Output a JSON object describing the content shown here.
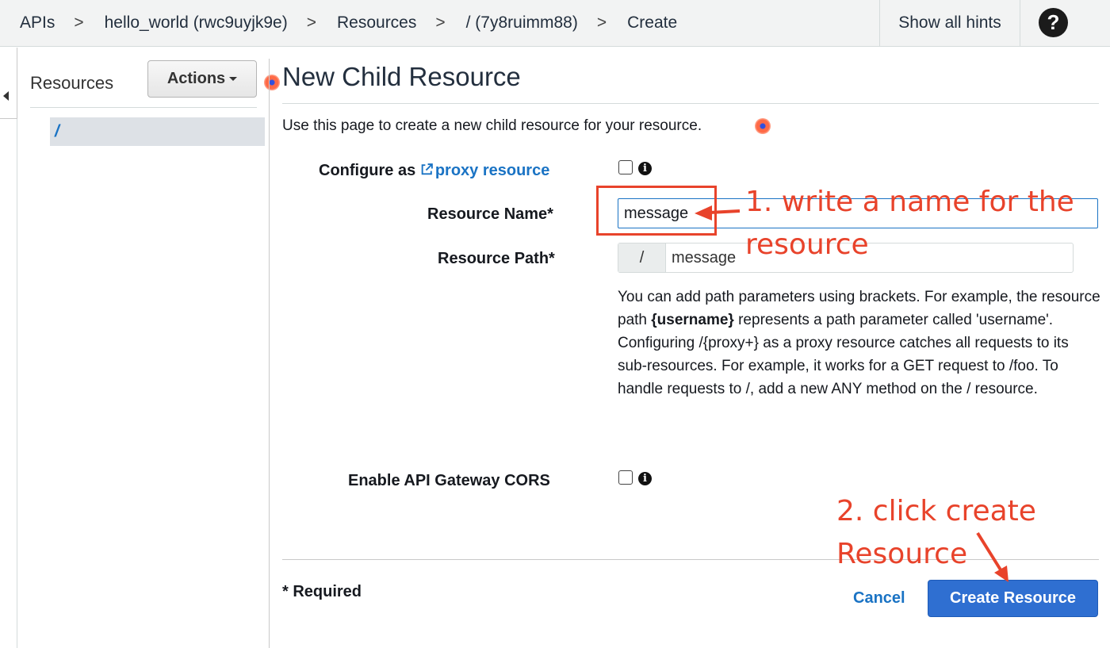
{
  "breadcrumb": [
    {
      "label": "APIs"
    },
    {
      "label": "hello_world (rwc9uyjk9e)"
    },
    {
      "label": "Resources"
    },
    {
      "label": "/ (7y8ruimm88)"
    },
    {
      "label": "Create"
    }
  ],
  "breadcrumb_separator": ">",
  "header": {
    "show_hints_label": "Show all hints",
    "help_icon_glyph": "?"
  },
  "sidebar": {
    "title": "Resources",
    "actions_label": "Actions",
    "tree": [
      {
        "label": "/"
      }
    ]
  },
  "form": {
    "title": "New Child Resource",
    "intro": "Use this page to create a new child resource for your resource.",
    "proxy_label_prefix": "Configure as",
    "proxy_link": "proxy resource",
    "resource_name_label": "Resource Name*",
    "resource_name_value": "message",
    "resource_path_label": "Resource Path*",
    "path_prefix": "/",
    "resource_path_value": "message",
    "help_text_before": "You can add path parameters using brackets. For example, the resource path ",
    "help_text_bold": "{username}",
    "help_text_after": " represents a path parameter called 'username'. Configuring /{proxy+} as a proxy resource catches all requests to its sub-resources. For example, it works for a GET request to /foo. To handle requests to /, add a new ANY method on the / resource.",
    "cors_label": "Enable API Gateway CORS",
    "info_icon_glyph": "i",
    "required_note": "* Required",
    "cancel_label": "Cancel",
    "create_label": "Create Resource"
  },
  "annotations": {
    "step1_line1": "1. write a name for the",
    "step1_line2": "resource",
    "step2_line1": "2. click create",
    "step2_line2": "Resource",
    "color": "#e8432b"
  },
  "icons": {
    "help": "question-circle-icon",
    "info": "info-circle-icon",
    "external_link": "external-link-icon",
    "collapse": "caret-left-icon",
    "hint": "hint-dot-icon"
  },
  "colors": {
    "link": "#1a73c4",
    "primary_button": "#2f6fd1",
    "header_bg": "#f2f3f3"
  }
}
